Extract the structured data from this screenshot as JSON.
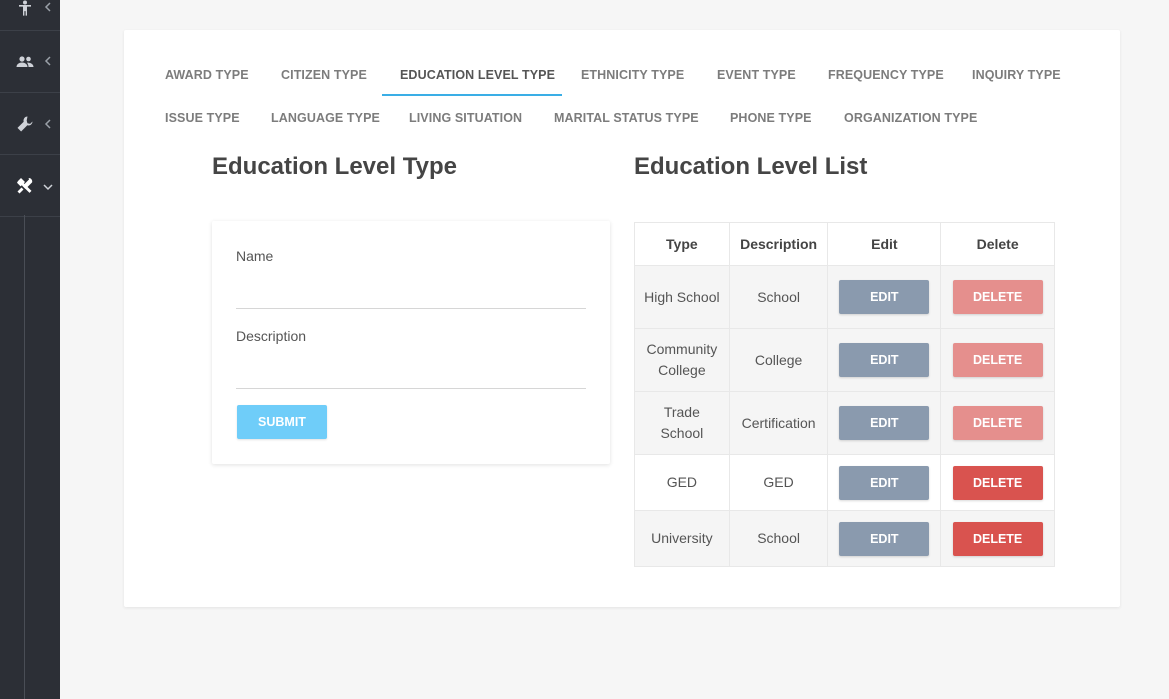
{
  "sidebar": {
    "items": [
      {
        "icon": "person-icon"
      },
      {
        "icon": "people-icon"
      },
      {
        "icon": "wrench-icon"
      },
      {
        "icon": "tools-icon",
        "expanded": true
      }
    ]
  },
  "tabs": [
    {
      "label": "AWARD TYPE"
    },
    {
      "label": "CITIZEN TYPE"
    },
    {
      "label": "EDUCATION LEVEL TYPE",
      "active": true
    },
    {
      "label": "ETHNICITY TYPE"
    },
    {
      "label": "EVENT TYPE"
    },
    {
      "label": "FREQUENCY TYPE"
    },
    {
      "label": "INQUIRY TYPE"
    },
    {
      "label": "ISSUE TYPE"
    },
    {
      "label": "LANGUAGE TYPE"
    },
    {
      "label": "LIVING SITUATION"
    },
    {
      "label": "MARITAL STATUS TYPE"
    },
    {
      "label": "PHONE TYPE"
    },
    {
      "label": "ORGANIZATION TYPE"
    }
  ],
  "form": {
    "title": "Education Level Type",
    "name_label": "Name",
    "name_value": "",
    "description_label": "Description",
    "description_value": "",
    "submit_label": "SUBMIT"
  },
  "list": {
    "title": "Education Level List",
    "headers": {
      "type": "Type",
      "description": "Description",
      "edit": "Edit",
      "delete": "Delete"
    },
    "edit_label": "EDIT",
    "delete_label": "DELETE",
    "rows": [
      {
        "type": "High School",
        "description": "School"
      },
      {
        "type": "Community College",
        "description": "College"
      },
      {
        "type": "Trade School",
        "description": "Certification"
      },
      {
        "type": "GED",
        "description": "GED"
      },
      {
        "type": "University",
        "description": "School"
      }
    ]
  },
  "colors": {
    "accent": "#3aaee6",
    "submit": "#6fcdf9",
    "edit": "#8a9aae",
    "delete": "#d9534f",
    "delete_faded": "#e58f8d",
    "sidebar": "#2c2f36"
  }
}
